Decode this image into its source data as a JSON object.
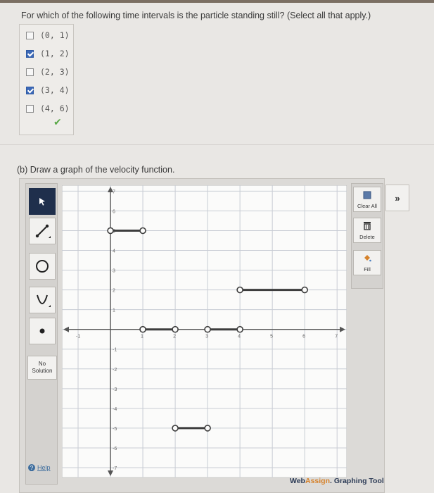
{
  "part_a": {
    "question": "For which of the following time intervals is the particle standing still? (Select all that apply.)",
    "choices": [
      {
        "label": "(0, 1)",
        "checked": false
      },
      {
        "label": "(1, 2)",
        "checked": true
      },
      {
        "label": "(2, 3)",
        "checked": false
      },
      {
        "label": "(3, 4)",
        "checked": true
      },
      {
        "label": "(4, 6)",
        "checked": false
      }
    ],
    "status_icon": "checkmark-icon"
  },
  "part_b": {
    "prompt": "(b) Draw a graph of the velocity function."
  },
  "graph_tool": {
    "left_tools": [
      "pointer-icon",
      "line-tool-icon",
      "circle-tool-icon",
      "parabola-tool-icon",
      "point-tool-icon"
    ],
    "no_solution_line1": "No",
    "no_solution_line2": "Solution",
    "help_label": "Help",
    "right_tools": {
      "clear_all": "Clear All",
      "delete": "Delete",
      "fill": "Fill"
    },
    "expand_label": "»",
    "brand_a": "Web",
    "brand_b": "Assign",
    "brand_c": ". Graphing Tool"
  },
  "chart_data": {
    "type": "line",
    "xlim": [
      -1.5,
      7.3
    ],
    "ylim": [
      -7.5,
      7.3
    ],
    "x_ticks": [
      -1,
      1,
      2,
      3,
      4,
      5,
      6,
      7
    ],
    "y_ticks": [
      7,
      6,
      5,
      4,
      3,
      2,
      1,
      -1,
      -2,
      -3,
      -4,
      -5,
      -6,
      -7
    ],
    "grid": true,
    "segments": [
      {
        "x": [
          0,
          1
        ],
        "y": [
          5,
          5
        ]
      },
      {
        "x": [
          1,
          2
        ],
        "y": [
          0,
          0
        ]
      },
      {
        "x": [
          2,
          3
        ],
        "y": [
          -5,
          -5
        ]
      },
      {
        "x": [
          3,
          4
        ],
        "y": [
          0,
          0
        ]
      },
      {
        "x": [
          4,
          6
        ],
        "y": [
          2,
          2
        ]
      }
    ]
  }
}
